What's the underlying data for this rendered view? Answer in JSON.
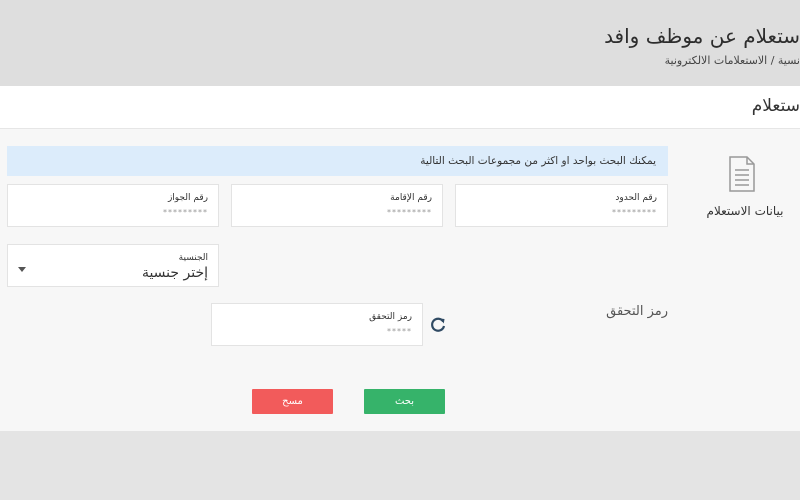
{
  "header": {
    "title": "ستعلام عن موظف وافد",
    "breadcrumb": "نسية / الاستعلامات الالكترونية"
  },
  "card": {
    "title": "ستعلام",
    "section_label": "بيانات الاستعلام",
    "info_text": "يمكنك البحث بواحد او اكثر من مجموعات البحث التالية"
  },
  "fields": {
    "border": {
      "label": "رقم الحدود",
      "value": "*********"
    },
    "residency": {
      "label": "رقم الإقامة",
      "value": "*********"
    },
    "passport": {
      "label": "رقم الجواز",
      "value": "*********"
    },
    "nationality": {
      "label": "الجنسية",
      "value": "إختر جنسية"
    }
  },
  "captcha": {
    "section_label": "رمز التحقق",
    "label": "رمز التحقق",
    "value": "*****",
    "refresh_icon": "refresh-icon"
  },
  "buttons": {
    "search": "بحث",
    "clear": "مسح"
  },
  "colors": {
    "info_bg": "#dcecfb",
    "search_btn": "#36b36a",
    "clear_btn": "#f25b5b",
    "refresh_icon": "#2f4a63"
  }
}
